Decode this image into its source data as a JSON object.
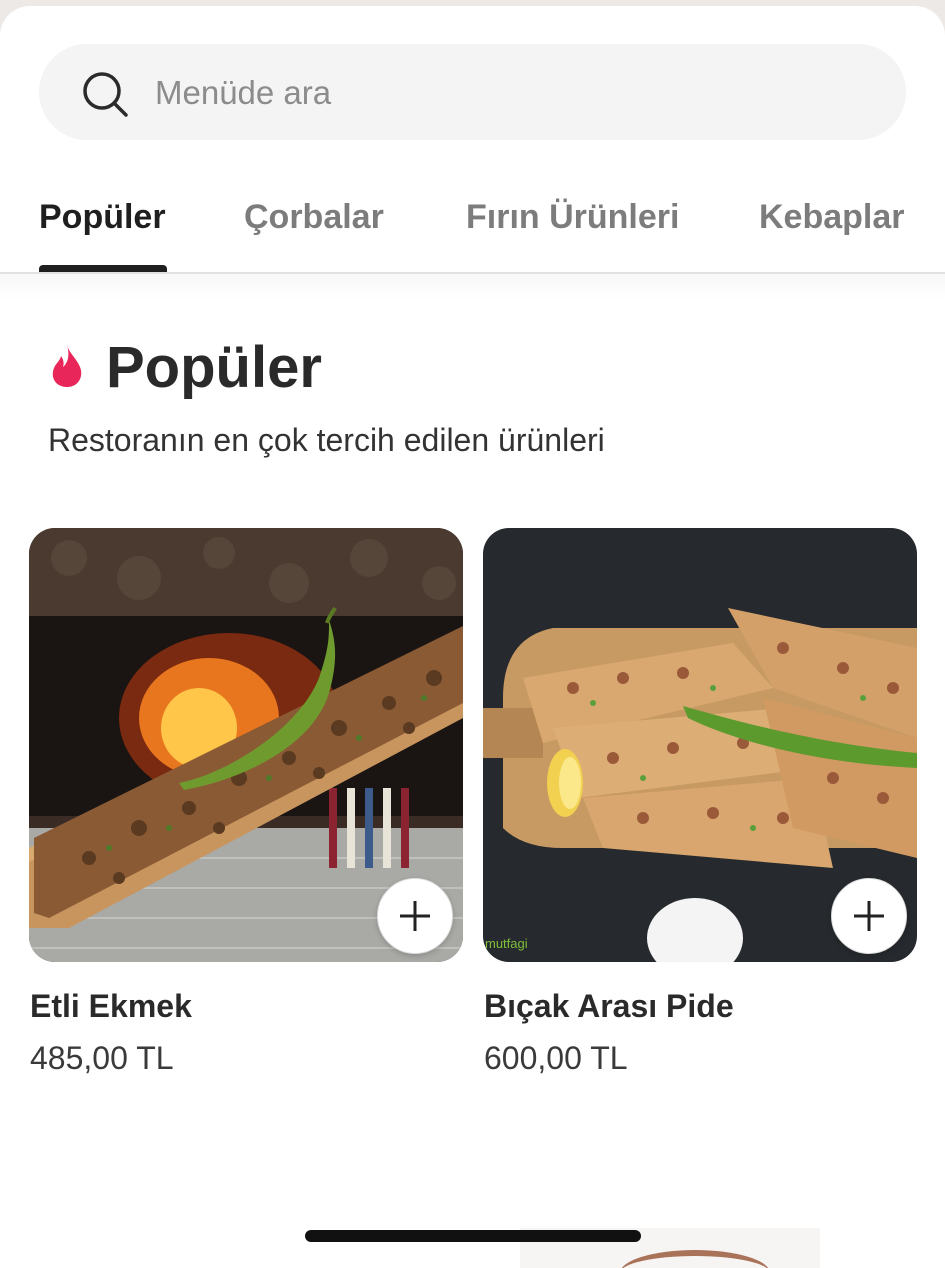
{
  "search": {
    "placeholder": "Menüde ara",
    "value": ""
  },
  "tabs": [
    {
      "label": "Popüler",
      "active": true
    },
    {
      "label": "Çorbalar",
      "active": false
    },
    {
      "label": "Fırın Ürünleri",
      "active": false
    },
    {
      "label": "Kebaplar",
      "active": false
    }
  ],
  "section": {
    "icon": "fire-icon",
    "title": "Popüler",
    "subtitle": "Restoranın en çok tercih edilen ürünleri"
  },
  "products": [
    {
      "name": "Etli Ekmek",
      "price": "485,00 TL",
      "image": "flatbread-on-wooden-board"
    },
    {
      "name": "Bıçak Arası Pide",
      "price": "600,00 TL",
      "image": "sliced-pide-with-pepper",
      "watermark": "mutfagi"
    }
  ],
  "colors": {
    "accent": "#e8265a",
    "text_primary": "#2a2a2a",
    "text_secondary": "#7c7c7c",
    "search_bg": "#f4f4f4"
  }
}
